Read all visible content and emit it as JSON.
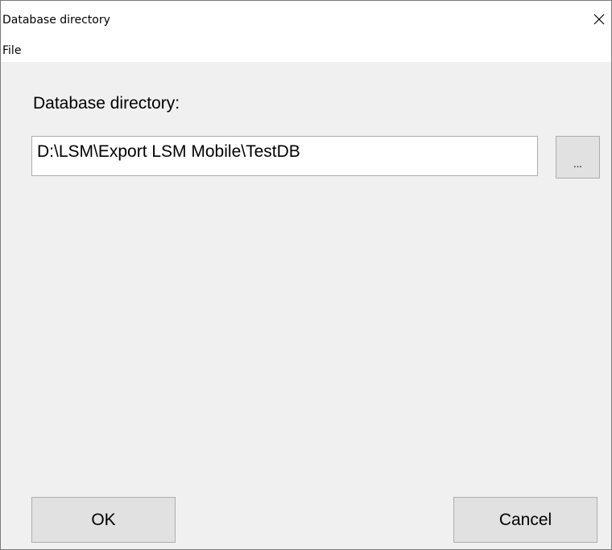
{
  "window": {
    "title": "Database directory"
  },
  "menu": {
    "file": "File"
  },
  "form": {
    "label": "Database directory:",
    "path_value": "D:\\LSM\\Export LSM Mobile\\TestDB",
    "browse_label": "..."
  },
  "buttons": {
    "ok": "OK",
    "cancel": "Cancel"
  },
  "icons": {
    "close": "close-icon"
  }
}
